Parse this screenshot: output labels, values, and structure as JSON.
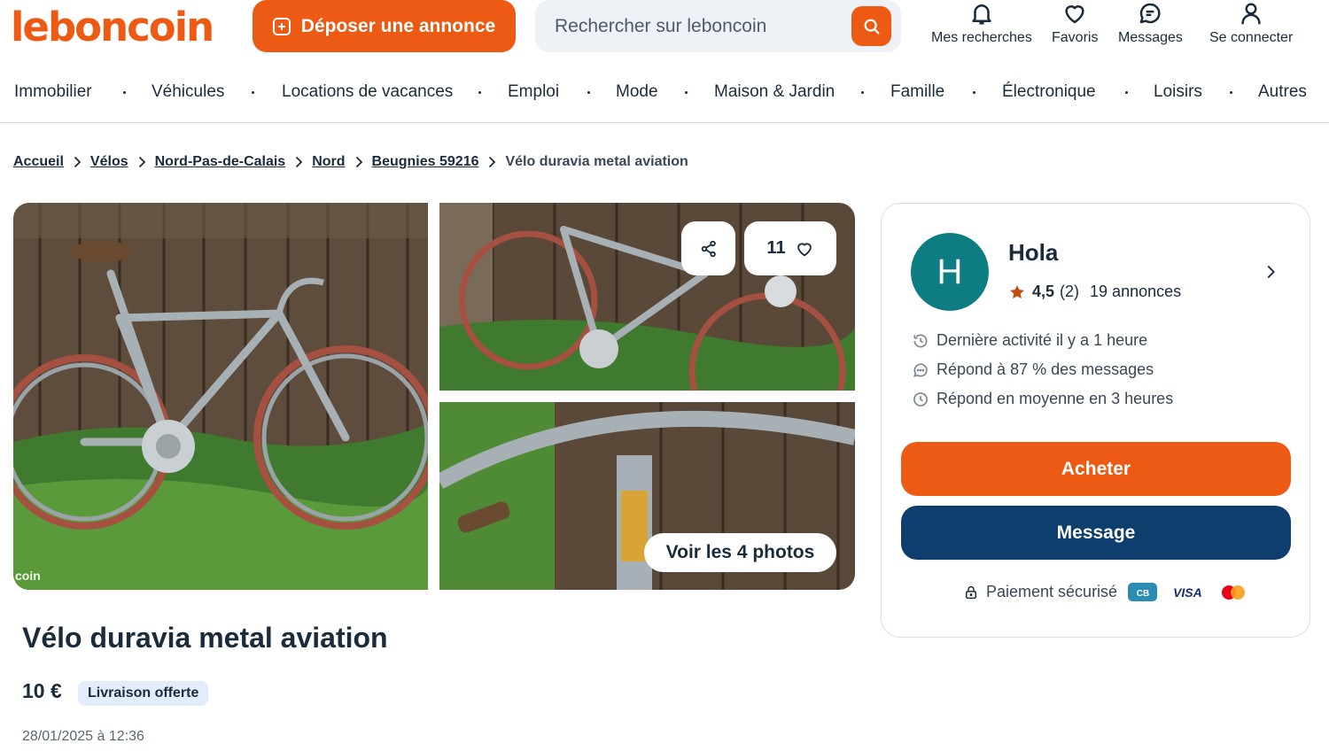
{
  "header": {
    "logo": "leboncoin",
    "deposit_label": "Déposer une annonce",
    "search_placeholder": "Rechercher sur leboncoin",
    "icons": [
      {
        "name": "bell-icon",
        "label": "Mes recherches"
      },
      {
        "name": "heart-icon",
        "label": "Favoris"
      },
      {
        "name": "message-icon",
        "label": "Messages"
      },
      {
        "name": "user-icon",
        "label": "Se connecter"
      }
    ]
  },
  "categories": [
    "Immobilier",
    "Véhicules",
    "Locations de vacances",
    "Emploi",
    "Mode",
    "Maison & Jardin",
    "Famille",
    "Électronique",
    "Loisirs",
    "Autres"
  ],
  "breadcrumb": {
    "links": [
      "Accueil",
      "Vélos",
      "Nord-Pas-de-Calais",
      "Nord",
      "Beugnies 59216"
    ],
    "current": "Vélo duravia metal aviation"
  },
  "gallery": {
    "watermark": "coin",
    "favorites_count": "11",
    "see_photos_label": "Voir les 4 photos"
  },
  "ad": {
    "title": "Vélo duravia metal aviation",
    "price": "10 €",
    "delivery_badge": "Livraison offerte",
    "date": "28/01/2025 à 12:36"
  },
  "seller": {
    "initial": "H",
    "name": "Hola",
    "rating": "4,5",
    "rating_count": "(2)",
    "listings": "19 annonces",
    "last_activity": "Dernière activité il y a 1 heure",
    "response_rate": "Répond à 87 % des messages",
    "response_time": "Répond en moyenne en 3 heures",
    "buy_label": "Acheter",
    "message_label": "Message",
    "secure_payment": "Paiement sécurisé",
    "card_cb": "CB",
    "card_visa": "VISA"
  },
  "colors": {
    "brand_orange": "#ec5a13",
    "navy": "#0d3e6d",
    "avatar_teal": "#0e7c83",
    "badge_blue": "#e2ecfb"
  }
}
